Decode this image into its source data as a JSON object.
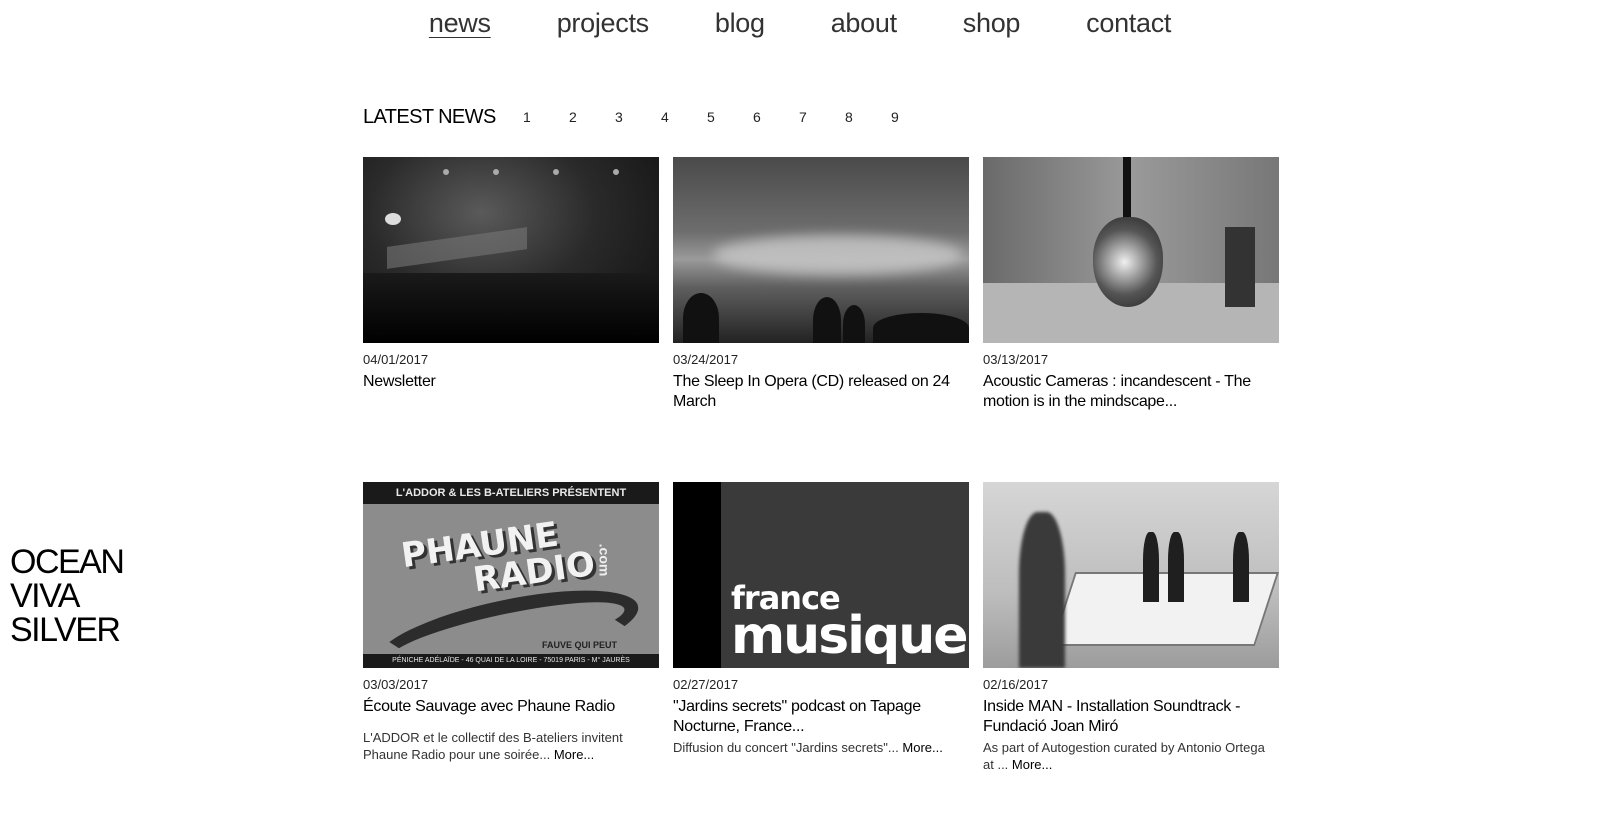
{
  "nav": {
    "items": [
      {
        "label": "news",
        "active": true
      },
      {
        "label": "projects",
        "active": false
      },
      {
        "label": "blog",
        "active": false
      },
      {
        "label": "about",
        "active": false
      },
      {
        "label": "shop",
        "active": false
      },
      {
        "label": "contact",
        "active": false
      }
    ]
  },
  "brand": {
    "line1": "OCEAN",
    "line2": "VIVA",
    "line3": "SILVER"
  },
  "news": {
    "heading": "LATEST NEWS",
    "pages": [
      "1",
      "2",
      "3",
      "4",
      "5",
      "6",
      "7",
      "8",
      "9"
    ],
    "posts": [
      {
        "date": "04/01/2017",
        "title": "Newsletter",
        "desc": "",
        "more": ""
      },
      {
        "date": "03/24/2017",
        "title": "The Sleep In Opera (CD) released on 24 March",
        "desc": "",
        "more": ""
      },
      {
        "date": "03/13/2017",
        "title": "Acoustic Cameras : incandescent - The motion is in the mindscape...",
        "desc": "",
        "more": ""
      },
      {
        "date": "03/03/2017",
        "title": "Écoute Sauvage avec Phaune Radio",
        "desc": "L'ADDOR et le collectif des B-ateliers invitent Phaune Radio pour une soirée...",
        "more": "More..."
      },
      {
        "date": "02/27/2017",
        "title": "\"Jardins secrets\" podcast on Tapage Nocturne, France...",
        "desc": "Diffusion du concert \"Jardins secrets\"...",
        "more": "More..."
      },
      {
        "date": "02/16/2017",
        "title": "Inside MAN - Installation Soundtrack - Fundació Joan Miró",
        "desc": "As part of Autogestion curated by Antonio Ortega at ...",
        "more": "More..."
      }
    ]
  },
  "images": {
    "radio_top": "L'ADDOR & LES B-ATELIERS PRÉSENTENT",
    "radio_logo_1": "PHAUNE",
    "radio_logo_2": "RADIO",
    "radio_logo_com": ".com",
    "radio_tag": "FAUVE QUI PEUT",
    "radio_bottom": "PÉNICHE ADÉLAÏDE - 46 QUAI DE LA LOIRE - 75019 PARIS - M° JAURÈS",
    "fm_line1": "france",
    "fm_line2": "musique"
  }
}
